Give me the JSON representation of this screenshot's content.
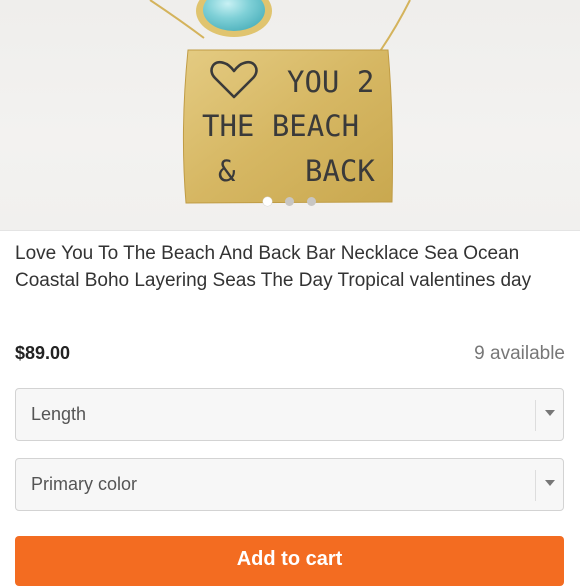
{
  "product": {
    "stamp_lines": [
      "YOU 2",
      "THE BEACH",
      "&",
      "BACK"
    ],
    "title": "Love You To The Beach And Back Bar Necklace Sea Ocean Coastal Boho Layering Seas The Day Tropical valentines day",
    "price": "$89.00",
    "availability": "9 available"
  },
  "options": [
    {
      "label": "Length"
    },
    {
      "label": "Primary color"
    }
  ],
  "cart": {
    "label": "Add to cart"
  },
  "carousel": {
    "count": 3,
    "active": 1
  },
  "colors": {
    "accent": "#f36c21",
    "gold": "#d9b963",
    "stone": "#7fd0d7"
  }
}
